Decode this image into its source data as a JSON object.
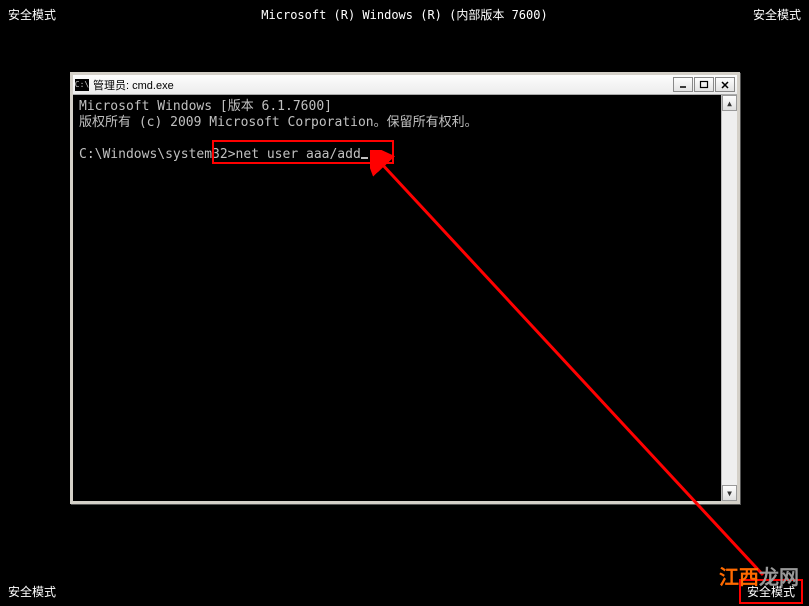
{
  "desktop": {
    "top_title": "Microsoft (R) Windows (R) (内部版本 7600)",
    "safe_mode_label": "安全模式"
  },
  "window": {
    "title": "管理员: cmd.exe",
    "icon_text": "C:\\"
  },
  "terminal": {
    "line1": "Microsoft Windows [版本 6.1.7600]",
    "line2": "版权所有 (c) 2009 Microsoft Corporation。保留所有权利。",
    "prompt": "C:\\Windows\\system32>",
    "command": "net user aaa/add"
  },
  "watermark": {
    "part1": "江西",
    "part2": "龙网"
  }
}
